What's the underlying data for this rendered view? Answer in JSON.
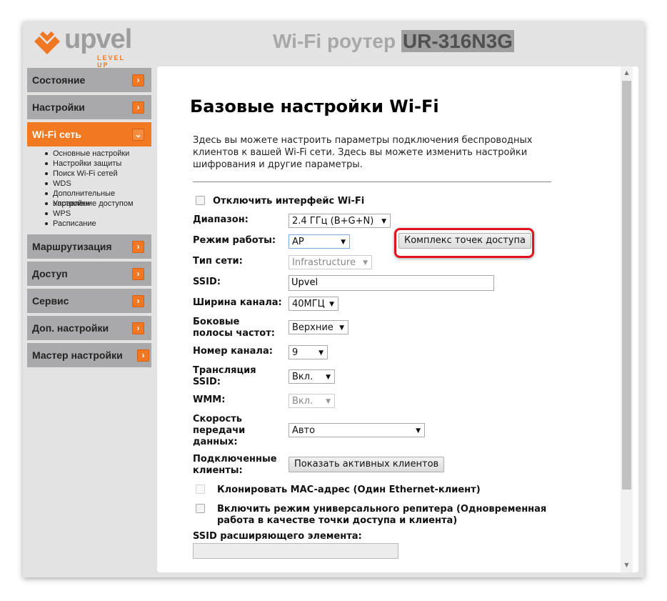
{
  "header": {
    "logo_word": "upvel",
    "logo_tagline": "LEVEL UP",
    "title_prefix": "Wi-Fi роутер",
    "model": "UR-316N3G"
  },
  "sidebar": {
    "items": [
      {
        "label": "Состояние",
        "icon": "chevron-right-icon"
      },
      {
        "label": "Настройки",
        "icon": "chevron-right-icon"
      },
      {
        "label": "Wi-Fi сеть",
        "icon": "chevron-down-icon",
        "active": true
      },
      {
        "label": "Маршрутизация",
        "icon": "chevron-right-icon"
      },
      {
        "label": "Доступ",
        "icon": "chevron-right-icon"
      },
      {
        "label": "Сервис",
        "icon": "chevron-right-icon"
      },
      {
        "label": "Доп. настройки",
        "icon": "chevron-right-icon"
      },
      {
        "label": "Мастер настройки",
        "icon": "chevron-right-icon"
      }
    ],
    "submenu": [
      "Основные настройки",
      "Настройки защиты",
      "Поиск Wi-Fi сетей",
      "WDS",
      "Дополнительные настройки",
      "Управление доступом",
      "WPS",
      "Расписание"
    ]
  },
  "main": {
    "title": "Базовые настройки Wi-Fi",
    "description": "Здесь вы можете настроить параметры подключения беспроводных клиентов к вашей Wi-Fi сети. Здесь вы можете изменить настройки шифрования и другие параметры.",
    "disable_wifi": "Отключить интерфейс Wi-Fi",
    "band_label": "Диапазон:",
    "band_value": "2.4 ГГц (B+G+N)",
    "mode_label": "Режим работы:",
    "mode_value": "AP",
    "multi_ap_button": "Комплекс точек доступа",
    "net_type_label": "Тип сети:",
    "net_type_value": "Infrastructure",
    "ssid_label": "SSID:",
    "ssid_value": "Upvel",
    "width_label": "Ширина канала:",
    "width_value": "40МГЦ",
    "sideband_label_1": "Боковые",
    "sideband_label_2": "полосы частот:",
    "sideband_value": "Верхние",
    "channel_label": "Номер канала:",
    "channel_value": "9",
    "broadcast_label_1": "Трансляция",
    "broadcast_label_2": "SSID:",
    "broadcast_value": "Вкл.",
    "wmm_label": "WMM:",
    "wmm_value": "Вкл.",
    "rate_label_1": "Скорость",
    "rate_label_2": "передачи",
    "rate_label_3": "данных:",
    "rate_value": "Авто",
    "clients_label_1": "Подключенные",
    "clients_label_2": "клиенты:",
    "clients_button": "Показать активных клиентов",
    "clone_mac": "Клонировать MAC-адрес (Один Ethernet-клиент)",
    "repeater_1": "Включить режим универсального репитера (Одновременная",
    "repeater_2": "работа в качестве точки доступа и клиента)",
    "ext_ssid_label": "SSID расширяющего элемента:",
    "ext_ssid_value": ""
  },
  "colors": {
    "accent": "#f07922",
    "highlight": "#e3101e"
  }
}
